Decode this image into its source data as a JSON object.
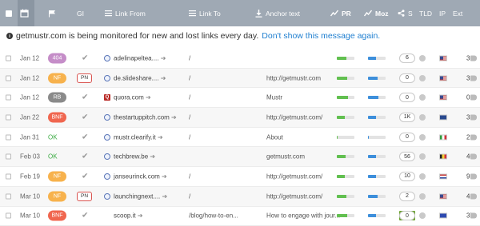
{
  "header": {
    "col_gi": "GI",
    "col_link_from": "Link From",
    "col_link_to": "Link To",
    "col_anchor": "Anchor text",
    "col_pr": "PR",
    "col_moz": "Moz",
    "col_s": "S",
    "col_tld": "TLD",
    "col_ip": "IP",
    "col_ext": "Ext"
  },
  "notice": {
    "text": "getmustr.com is being monitored for new and lost links every day.",
    "link": "Don't show this message again."
  },
  "rows": [
    {
      "date": "Jan 12",
      "status": "404",
      "status_color": "#c58dc8",
      "pn": "",
      "domain": "adelinapeltea....",
      "link_to": "/",
      "anchor": "",
      "pr": 0.55,
      "moz": 0.45,
      "s": "6",
      "flag": "us",
      "ext": "36"
    },
    {
      "date": "Jan 12",
      "status": "NF",
      "status_color": "#f7b24d",
      "pn": "PN",
      "domain": "de.slideshare....",
      "link_to": "/",
      "anchor": "http://getmustr.com",
      "pr": 0.6,
      "moz": 0.55,
      "s": "0",
      "flag": "us",
      "ext": "3"
    },
    {
      "date": "Jan 12",
      "status": "RB",
      "status_color": "#8a8a8a",
      "pn": "",
      "domain": "quora.com",
      "link_to": "/",
      "anchor": "Mustr",
      "pr": 0.65,
      "moz": 0.6,
      "s": "0",
      "flag": "us",
      "ext": "0"
    },
    {
      "date": "Jan 22",
      "status": "BNF",
      "status_color": "#f0664f",
      "pn": "",
      "domain": "thestartuppitch.com",
      "link_to": "/",
      "anchor": "http://getmustr.com/",
      "pr": 0.45,
      "moz": 0.45,
      "s": "1K",
      "flag": "gb",
      "ext": "33"
    },
    {
      "date": "Jan 31",
      "status": "OK",
      "status_color": "",
      "pn": "",
      "domain": "mustr.clearify.it",
      "link_to": "/",
      "anchor": "About",
      "pr": 0.05,
      "moz": 0.05,
      "s": "0",
      "flag": "it",
      "ext": "2"
    },
    {
      "date": "Feb 03",
      "status": "OK",
      "status_color": "",
      "pn": "",
      "domain": "techbrew.be",
      "link_to": "",
      "anchor": "getmustr.com",
      "pr": 0.5,
      "moz": 0.45,
      "s": "56",
      "flag": "be",
      "ext": "40"
    },
    {
      "date": "Feb 19",
      "status": "NF",
      "status_color": "#f7b24d",
      "pn": "",
      "domain": "janseurinck.com",
      "link_to": "/",
      "anchor": "http://getmustr.com/",
      "pr": 0.45,
      "moz": 0.45,
      "s": "10",
      "flag": "nl",
      "ext": "9"
    },
    {
      "date": "Mar 10",
      "status": "NF",
      "status_color": "#f7b24d",
      "pn": "PN",
      "domain": "launchingnext....",
      "link_to": "/",
      "anchor": "http://getmustr.com/",
      "pr": 0.55,
      "moz": 0.55,
      "s": "2",
      "flag": "us",
      "ext": "4"
    },
    {
      "date": "Mar 10",
      "status": "BNF",
      "status_color": "#f0664f",
      "pn": "",
      "domain": "scoop.it",
      "link_to": "/blog/how-to-en...",
      "anchor": "How to engage with jour...",
      "pr": 0.6,
      "moz": 0.45,
      "s": "0",
      "flag": "eu",
      "ext": "37"
    }
  ]
}
